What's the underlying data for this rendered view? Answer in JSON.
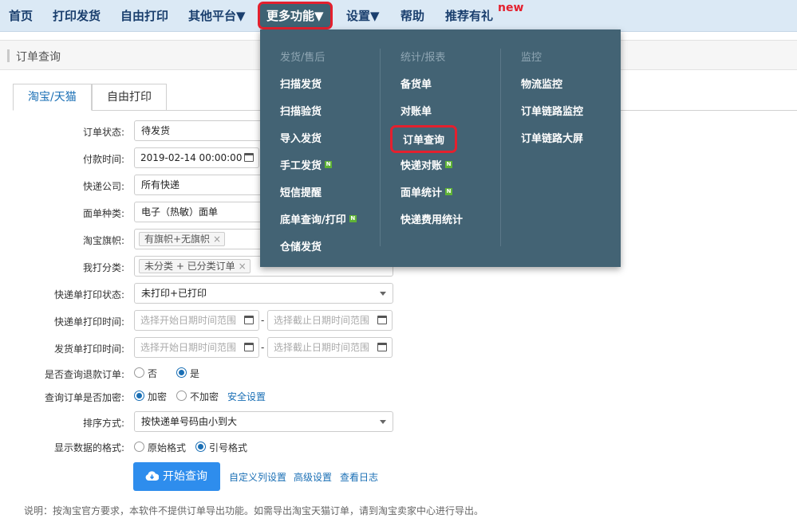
{
  "nav": {
    "items": [
      {
        "label": "首页"
      },
      {
        "label": "打印发货"
      },
      {
        "label": "自由打印"
      },
      {
        "label": "其他平台▼"
      },
      {
        "label": "更多功能▼"
      },
      {
        "label": "设置▼"
      },
      {
        "label": "帮助"
      },
      {
        "label": "推荐有礼"
      }
    ],
    "new_badge": "new"
  },
  "breadcrumb": "订单查询",
  "tabs": [
    {
      "label": "淘宝/天猫"
    },
    {
      "label": "自由打印"
    }
  ],
  "form": {
    "order_status": {
      "label": "订单状态:",
      "value": "待发货"
    },
    "pay_time": {
      "label": "付款时间:",
      "start": "2019-02-14 00:00:00"
    },
    "express_company": {
      "label": "快递公司:",
      "value": "所有快递"
    },
    "waybill_type": {
      "label": "面单种类:",
      "value": "电子（热敏）面单"
    },
    "taobao_flag": {
      "label": "淘宝旗帜:",
      "tag": "有旗帜+无旗帜"
    },
    "my_category": {
      "label": "我打分类:",
      "tag": "未分类 + 已分类订单"
    },
    "express_print_status": {
      "label": "快递单打印状态:",
      "value": "未打印+已打印"
    },
    "express_print_time": {
      "label": "快递单打印时间:",
      "start_placeholder": "选择开始日期时间范围",
      "end_placeholder": "选择截止日期时间范围"
    },
    "invoice_print_time": {
      "label": "发货单打印时间:",
      "start_placeholder": "选择开始日期时间范围",
      "end_placeholder": "选择截止日期时间范围"
    },
    "refund_query": {
      "label": "是否查询退款订单:",
      "options": [
        "否",
        "是"
      ],
      "selected": "是"
    },
    "encrypt": {
      "label": "查询订单是否加密:",
      "options": [
        "加密",
        "不加密"
      ],
      "selected": "加密",
      "link": "安全设置"
    },
    "sort": {
      "label": "排序方式:",
      "value": "按快递单号码由小到大"
    },
    "display_format": {
      "label": "显示数据的格式:",
      "options": [
        "原始格式",
        "引号格式"
      ],
      "selected": "引号格式"
    },
    "dash": "-"
  },
  "actions": {
    "query_button": "开始查询",
    "custom_columns": "自定义列设置",
    "advanced": "高级设置",
    "view_log": "查看日志"
  },
  "note": "说明：按淘宝官方要求，本软件不提供订单导出功能。如需导出淘宝天猫订单，请到淘宝卖家中心进行导出。",
  "menu": {
    "columns": [
      {
        "heading": "发货/售后",
        "items": [
          {
            "label": "扫描发货"
          },
          {
            "label": "扫描验货"
          },
          {
            "label": "导入发货"
          },
          {
            "label": "手工发货",
            "badge": "N"
          },
          {
            "label": "短信提醒"
          },
          {
            "label": "底单查询/打印",
            "badge": "N"
          },
          {
            "label": "仓储发货"
          }
        ]
      },
      {
        "heading": "统计/报表",
        "items": [
          {
            "label": "备货单"
          },
          {
            "label": "对账单"
          },
          {
            "label": "订单查询"
          },
          {
            "label": "快递对账",
            "badge": "N"
          },
          {
            "label": "面单统计",
            "badge": "N"
          },
          {
            "label": "快递费用统计"
          }
        ]
      },
      {
        "heading": "监控",
        "items": [
          {
            "label": "物流监控"
          },
          {
            "label": "订单链路监控"
          },
          {
            "label": "订单链路大屏"
          }
        ]
      }
    ]
  },
  "colors": {
    "nav_bg": "#dbe9f5",
    "menu_bg": "#436374",
    "highlight": "#e4202e",
    "primary": "#2e8ded",
    "link": "#1a6fb5"
  }
}
